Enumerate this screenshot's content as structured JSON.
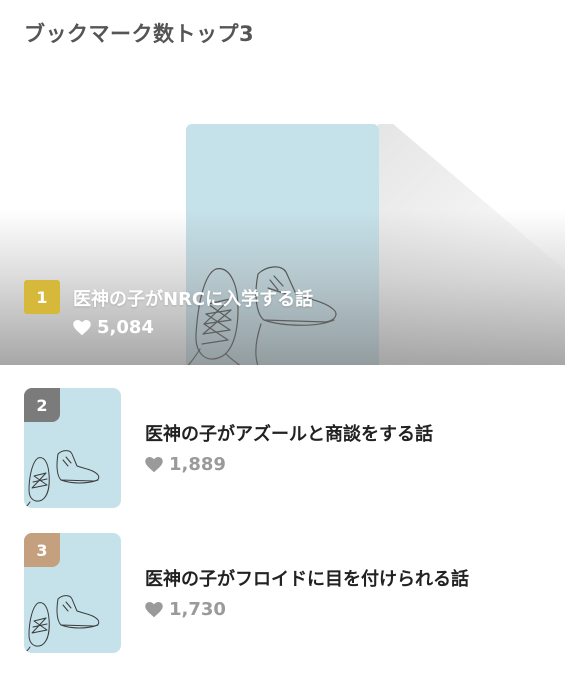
{
  "section_title": "ブックマーク数トップ3",
  "colors": {
    "rank1": "#d6b93a",
    "rank2": "#7b7b7b",
    "rank3": "#c4a07e",
    "cover": "#c5e1ea"
  },
  "ranking": [
    {
      "rank": "1",
      "title": "医神の子がNRCに入学する話",
      "likes": "5,084",
      "icon": "heart-icon"
    },
    {
      "rank": "2",
      "title": "医神の子がアズールと商談をする話",
      "likes": "1,889",
      "icon": "heart-icon"
    },
    {
      "rank": "3",
      "title": "医神の子がフロイドに目を付けられる話",
      "likes": "1,730",
      "icon": "heart-icon"
    }
  ]
}
